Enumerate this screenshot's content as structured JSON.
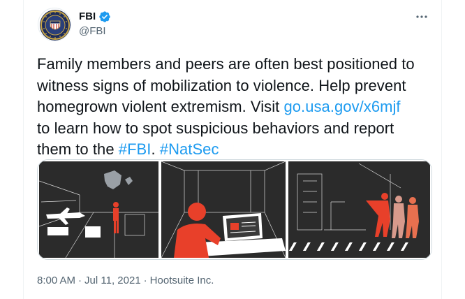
{
  "author": {
    "display_name": "FBI",
    "handle": "@FBI",
    "verified": true,
    "avatar_icon": "fbi-seal-icon"
  },
  "tweet": {
    "text_lines": [
      "Family members and peers are often best positioned to",
      "witness signs of mobilization to violence. Help prevent",
      "homegrown violent extremism. Visit ",
      "to learn how to spot suspicious behaviors and report",
      "them to the "
    ],
    "link": "go.usa.gov/x6mjf",
    "hashtag1": "#FBI",
    "separator": ". ",
    "hashtag2": "#NatSec"
  },
  "media": {
    "panels": [
      "airport-scene",
      "laptop-scene",
      "street-scene"
    ]
  },
  "meta": {
    "time": "8:00 AM",
    "dot1": "·",
    "date": "Jul 11, 2021",
    "dot2": "·",
    "source": "Hootsuite Inc."
  },
  "colors": {
    "link": "#1d9bf0",
    "verified": "#1d9bf0",
    "figure_red": "#e8402a",
    "panel_bg": "#2b2b2b"
  }
}
